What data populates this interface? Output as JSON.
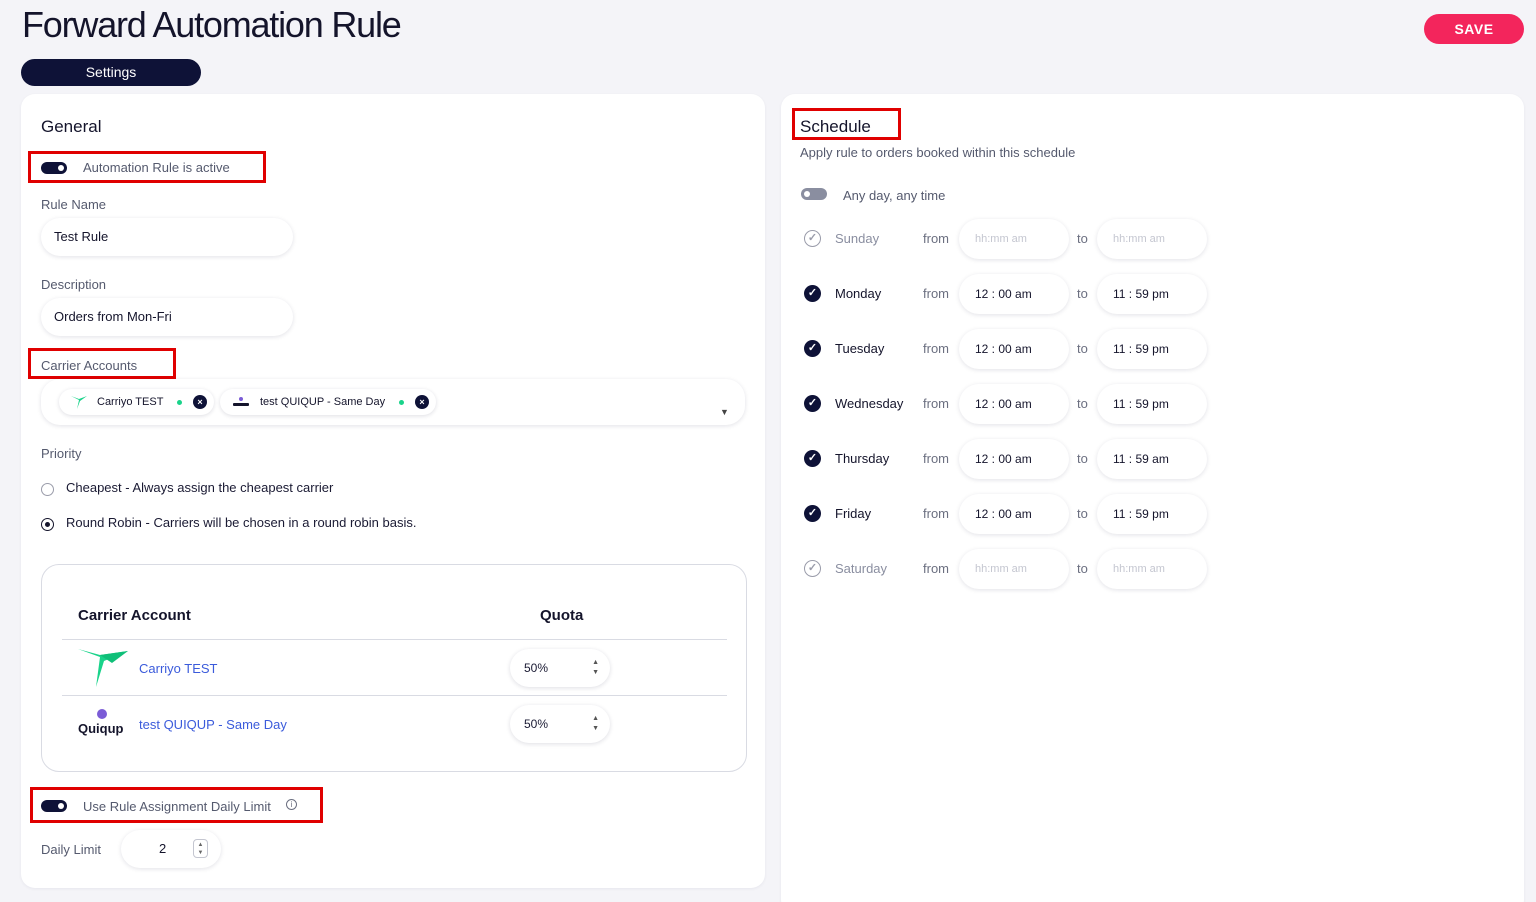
{
  "page": {
    "title": "Forward Automation Rule",
    "save_label": "SAVE",
    "tab_label": "Settings"
  },
  "general": {
    "title": "General",
    "active_toggle_label": "Automation Rule is active",
    "rule_name_label": "Rule Name",
    "rule_name_value": "Test Rule",
    "description_label": "Description",
    "description_value": "Orders from Mon-Fri",
    "carrier_accounts_label": "Carrier Accounts",
    "carrier_chips": [
      {
        "label": "Carriyo TEST",
        "status_color": "#19d38a"
      },
      {
        "label": "test QUIQUP - Same Day",
        "status_color": "#19d38a"
      }
    ],
    "priority_label": "Priority",
    "priority_options": [
      {
        "label": "Cheapest - Always assign the cheapest carrier",
        "selected": false
      },
      {
        "label": "Round Robin - Carriers will be chosen in a round robin basis.",
        "selected": true
      }
    ],
    "quota_table": {
      "headers": [
        "Carrier Account",
        "Quota"
      ],
      "rows": [
        {
          "name": "Carriyo TEST",
          "quota": "50%",
          "logo": "carriyo-logo"
        },
        {
          "name": "test QUIQUP - Same Day",
          "quota": "50%",
          "logo": "quiqup-logo",
          "logo_text": "Quiqup"
        }
      ]
    },
    "daily_limit_toggle_label": "Use Rule Assignment Daily Limit",
    "daily_limit_label": "Daily Limit",
    "daily_limit_value": "2"
  },
  "schedule": {
    "title": "Schedule",
    "subtitle": "Apply rule to orders booked within this schedule",
    "any_time_label": "Any day, any time",
    "from_label": "from",
    "to_label": "to",
    "placeholder": "hh:mm am",
    "days": [
      {
        "day": "Sunday",
        "enabled": false,
        "from": "",
        "to": ""
      },
      {
        "day": "Monday",
        "enabled": true,
        "from": "12 : 00  am",
        "to": "11 : 59  pm"
      },
      {
        "day": "Tuesday",
        "enabled": true,
        "from": "12 : 00  am",
        "to": "11 : 59  pm"
      },
      {
        "day": "Wednesday",
        "enabled": true,
        "from": "12 : 00  am",
        "to": "11 : 59  pm"
      },
      {
        "day": "Thursday",
        "enabled": true,
        "from": "12 : 00  am",
        "to": "11 : 59  am"
      },
      {
        "day": "Friday",
        "enabled": true,
        "from": "12 : 00  am",
        "to": "11 : 59  pm"
      },
      {
        "day": "Saturday",
        "enabled": false,
        "from": "",
        "to": ""
      }
    ]
  },
  "colors": {
    "primary": "#0e1237",
    "accent": "#f3255c",
    "link": "#3b5bdb",
    "status_active": "#19d38a",
    "highlight": "#e00000"
  }
}
